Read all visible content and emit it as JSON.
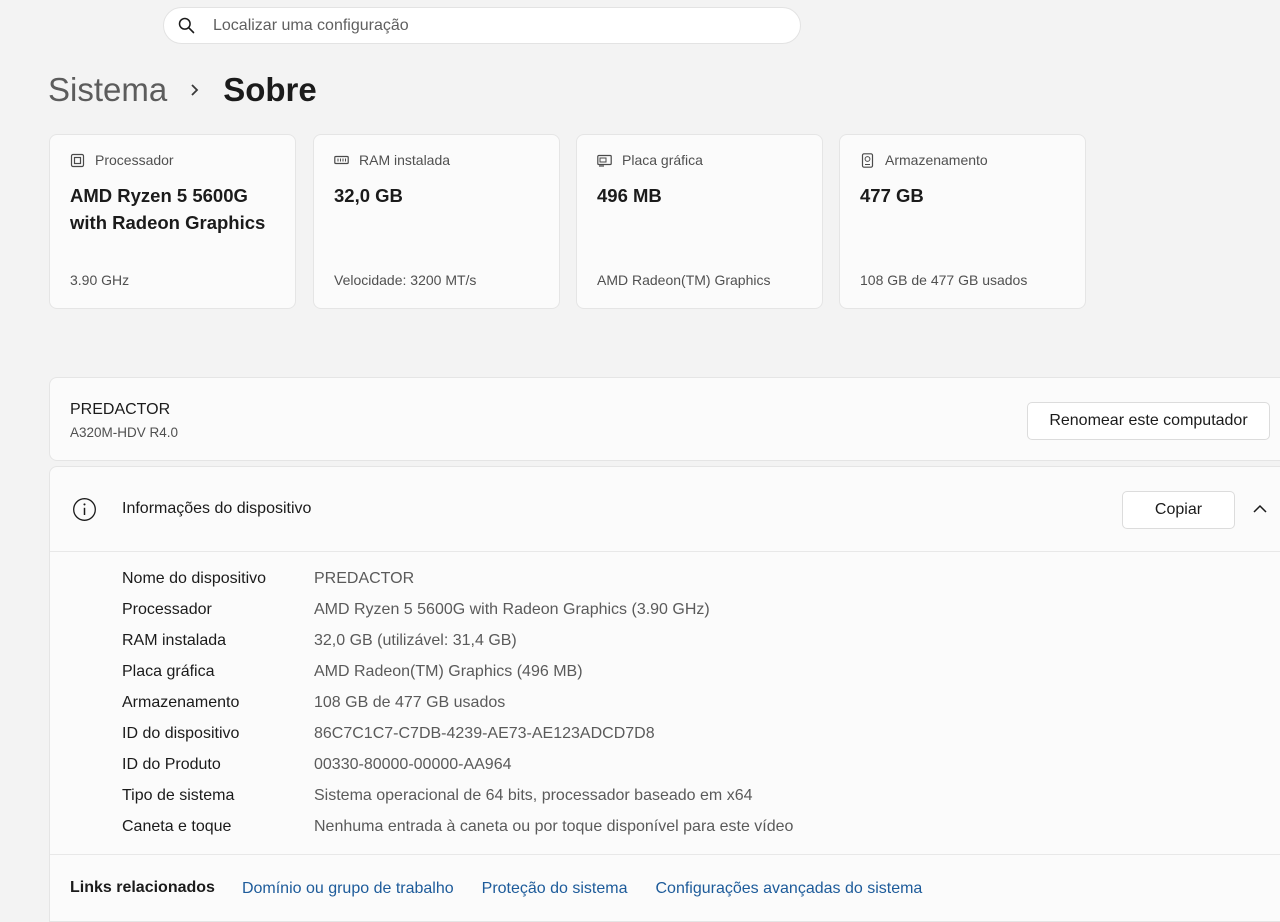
{
  "search": {
    "placeholder": "Localizar uma configuração"
  },
  "breadcrumb": {
    "parent": "Sistema",
    "current": "Sobre"
  },
  "cards": [
    {
      "label": "Processador",
      "value": "AMD Ryzen 5 5600G with Radeon Graphics",
      "sub": "3.90 GHz",
      "icon": "cpu-icon"
    },
    {
      "label": "RAM instalada",
      "value": "32,0 GB",
      "sub": "Velocidade: 3200 MT/s",
      "icon": "ram-icon"
    },
    {
      "label": "Placa gráfica",
      "value": "496 MB",
      "sub": "AMD Radeon(TM) Graphics",
      "icon": "gpu-icon"
    },
    {
      "label": "Armazenamento",
      "value": "477 GB",
      "sub": "108 GB de 477 GB usados",
      "icon": "storage-icon"
    }
  ],
  "device": {
    "name": "PREDACTOR",
    "model": "A320M-HDV R4.0",
    "rename_label": "Renomear este computador"
  },
  "info": {
    "title": "Informações do dispositivo",
    "copy_label": "Copiar",
    "rows": [
      {
        "label": "Nome do dispositivo",
        "value": "PREDACTOR"
      },
      {
        "label": "Processador",
        "value": "AMD Ryzen 5 5600G with Radeon Graphics (3.90 GHz)"
      },
      {
        "label": "RAM instalada",
        "value": "32,0 GB (utilizável: 31,4 GB)"
      },
      {
        "label": "Placa gráfica",
        "value": "AMD Radeon(TM) Graphics (496 MB)"
      },
      {
        "label": "Armazenamento",
        "value": "108 GB de 477 GB usados"
      },
      {
        "label": "ID do dispositivo",
        "value": "86C7C1C7-C7DB-4239-AE73-AE123ADCD7D8"
      },
      {
        "label": "ID do Produto",
        "value": "00330-80000-00000-AA964"
      },
      {
        "label": "Tipo de sistema",
        "value": "Sistema operacional de 64 bits, processador baseado em x64"
      },
      {
        "label": "Caneta e toque",
        "value": "Nenhuma entrada à caneta ou por toque disponível para este vídeo"
      }
    ]
  },
  "links": {
    "title": "Links relacionados",
    "items": [
      "Domínio ou grupo de trabalho",
      "Proteção do sistema",
      "Configurações avançadas do sistema"
    ]
  },
  "colors": {
    "link": "#1d5b9a",
    "background": "#f3f3f3",
    "card": "#fbfbfb"
  }
}
